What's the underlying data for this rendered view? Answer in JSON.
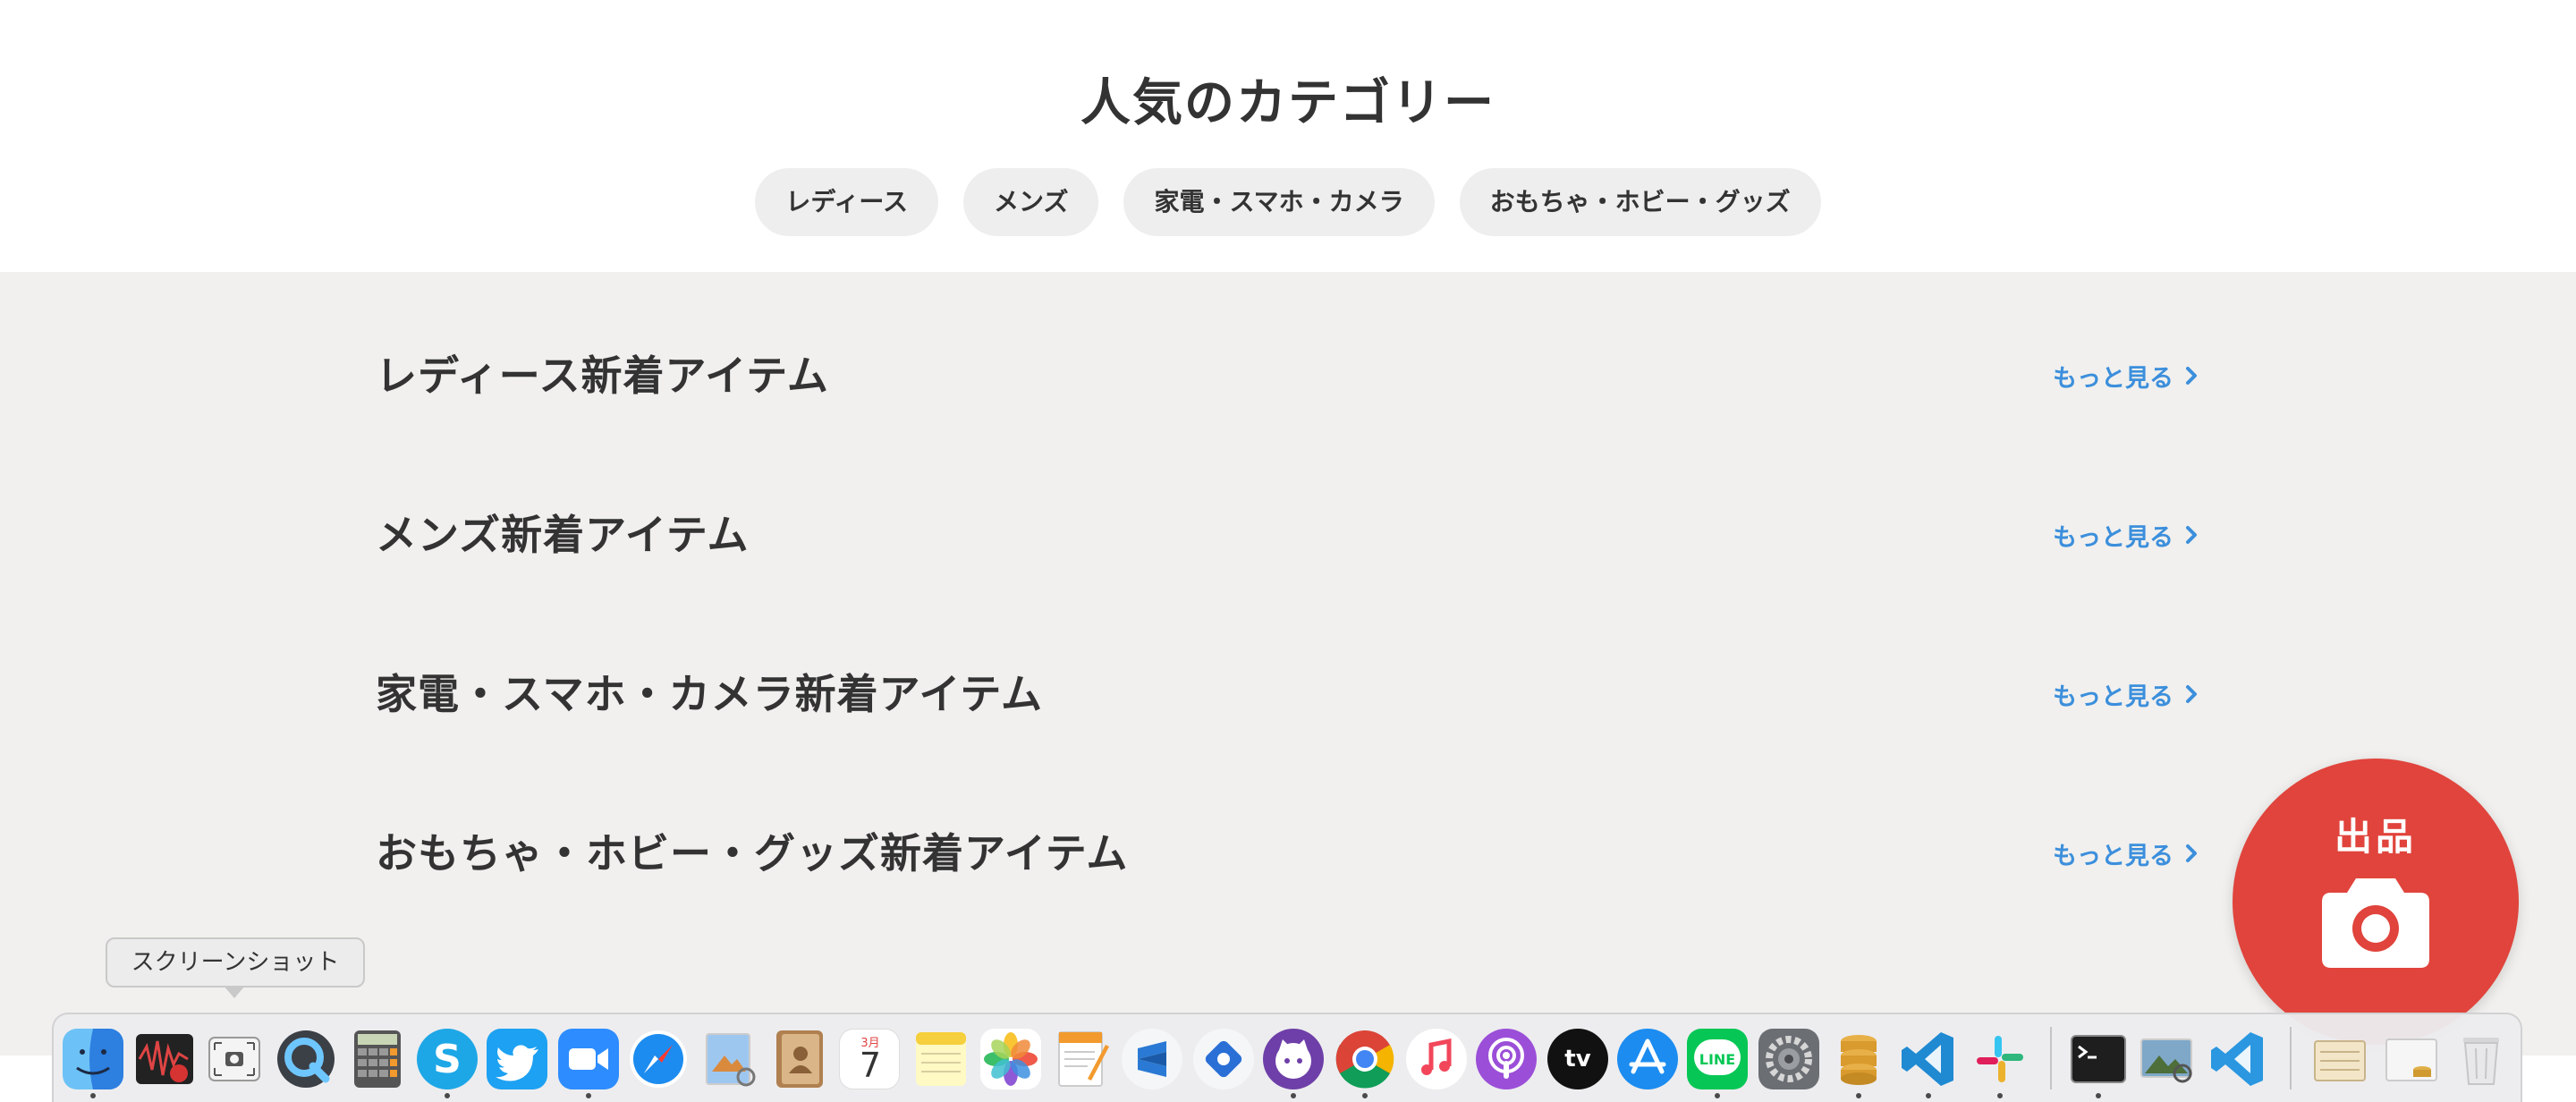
{
  "popular": {
    "title": "人気のカテゴリー",
    "chips": [
      "レディース",
      "メンズ",
      "家電・スマホ・カメラ",
      "おもちゃ・ホビー・グッズ"
    ]
  },
  "sections": [
    {
      "title": "レディース新着アイテム",
      "link": "もっと見る"
    },
    {
      "title": "メンズ新着アイテム",
      "link": "もっと見る"
    },
    {
      "title": "家電・スマホ・カメラ新着アイテム",
      "link": "もっと見る"
    },
    {
      "title": "おもちゃ・ホビー・グッズ新着アイテム",
      "link": "もっと見る"
    }
  ],
  "sell_button": {
    "label": "出品",
    "icon": "camera-icon",
    "color": "#e0443c"
  },
  "colors": {
    "link": "#3c8fdc",
    "section_bg": "#f1f0ee",
    "chip_bg": "#eeeeee",
    "text": "#333333"
  },
  "dock": {
    "tooltip": "スクリーンショット",
    "calendar": {
      "month": "3月",
      "day": "7"
    },
    "apps": [
      {
        "name": "finder-icon",
        "running": true
      },
      {
        "name": "audio-recorder-icon",
        "running": false
      },
      {
        "name": "screenshot-icon",
        "running": false
      },
      {
        "name": "quicktime-icon",
        "running": false
      },
      {
        "name": "calculator-icon",
        "running": false
      },
      {
        "name": "skype-icon",
        "running": true
      },
      {
        "name": "twitter-icon",
        "running": false
      },
      {
        "name": "zoom-icon",
        "running": true
      },
      {
        "name": "safari-icon",
        "running": false
      },
      {
        "name": "preview-icon",
        "running": false
      },
      {
        "name": "contacts-icon",
        "running": false
      },
      {
        "name": "calendar-icon",
        "running": false
      },
      {
        "name": "notes-icon",
        "running": false
      },
      {
        "name": "photos-icon",
        "running": false
      },
      {
        "name": "pages-icon",
        "running": false
      },
      {
        "name": "sublime-icon",
        "running": false
      },
      {
        "name": "teleport-icon",
        "running": false
      },
      {
        "name": "github-desktop-icon",
        "running": true
      },
      {
        "name": "chrome-icon",
        "running": true
      },
      {
        "name": "music-icon",
        "running": false
      },
      {
        "name": "podcasts-icon",
        "running": false
      },
      {
        "name": "apple-tv-icon",
        "running": false
      },
      {
        "name": "app-store-icon",
        "running": false
      },
      {
        "name": "line-icon",
        "running": true
      },
      {
        "name": "system-preferences-icon",
        "running": false
      },
      {
        "name": "sequel-pro-icon",
        "running": true
      },
      {
        "name": "vscode-icon",
        "running": true
      },
      {
        "name": "slack-icon",
        "running": true
      },
      {
        "name": "terminal-icon",
        "running": true
      },
      {
        "name": "image-viewer-icon",
        "running": false
      },
      {
        "name": "vscode-insiders-icon",
        "running": false
      },
      {
        "name": "documents-folder-icon",
        "running": false
      },
      {
        "name": "downloads-folder-icon",
        "running": false
      },
      {
        "name": "trash-icon",
        "running": false
      }
    ],
    "tv_label": "tv",
    "line_label": "LINE",
    "skype_label": "S"
  }
}
